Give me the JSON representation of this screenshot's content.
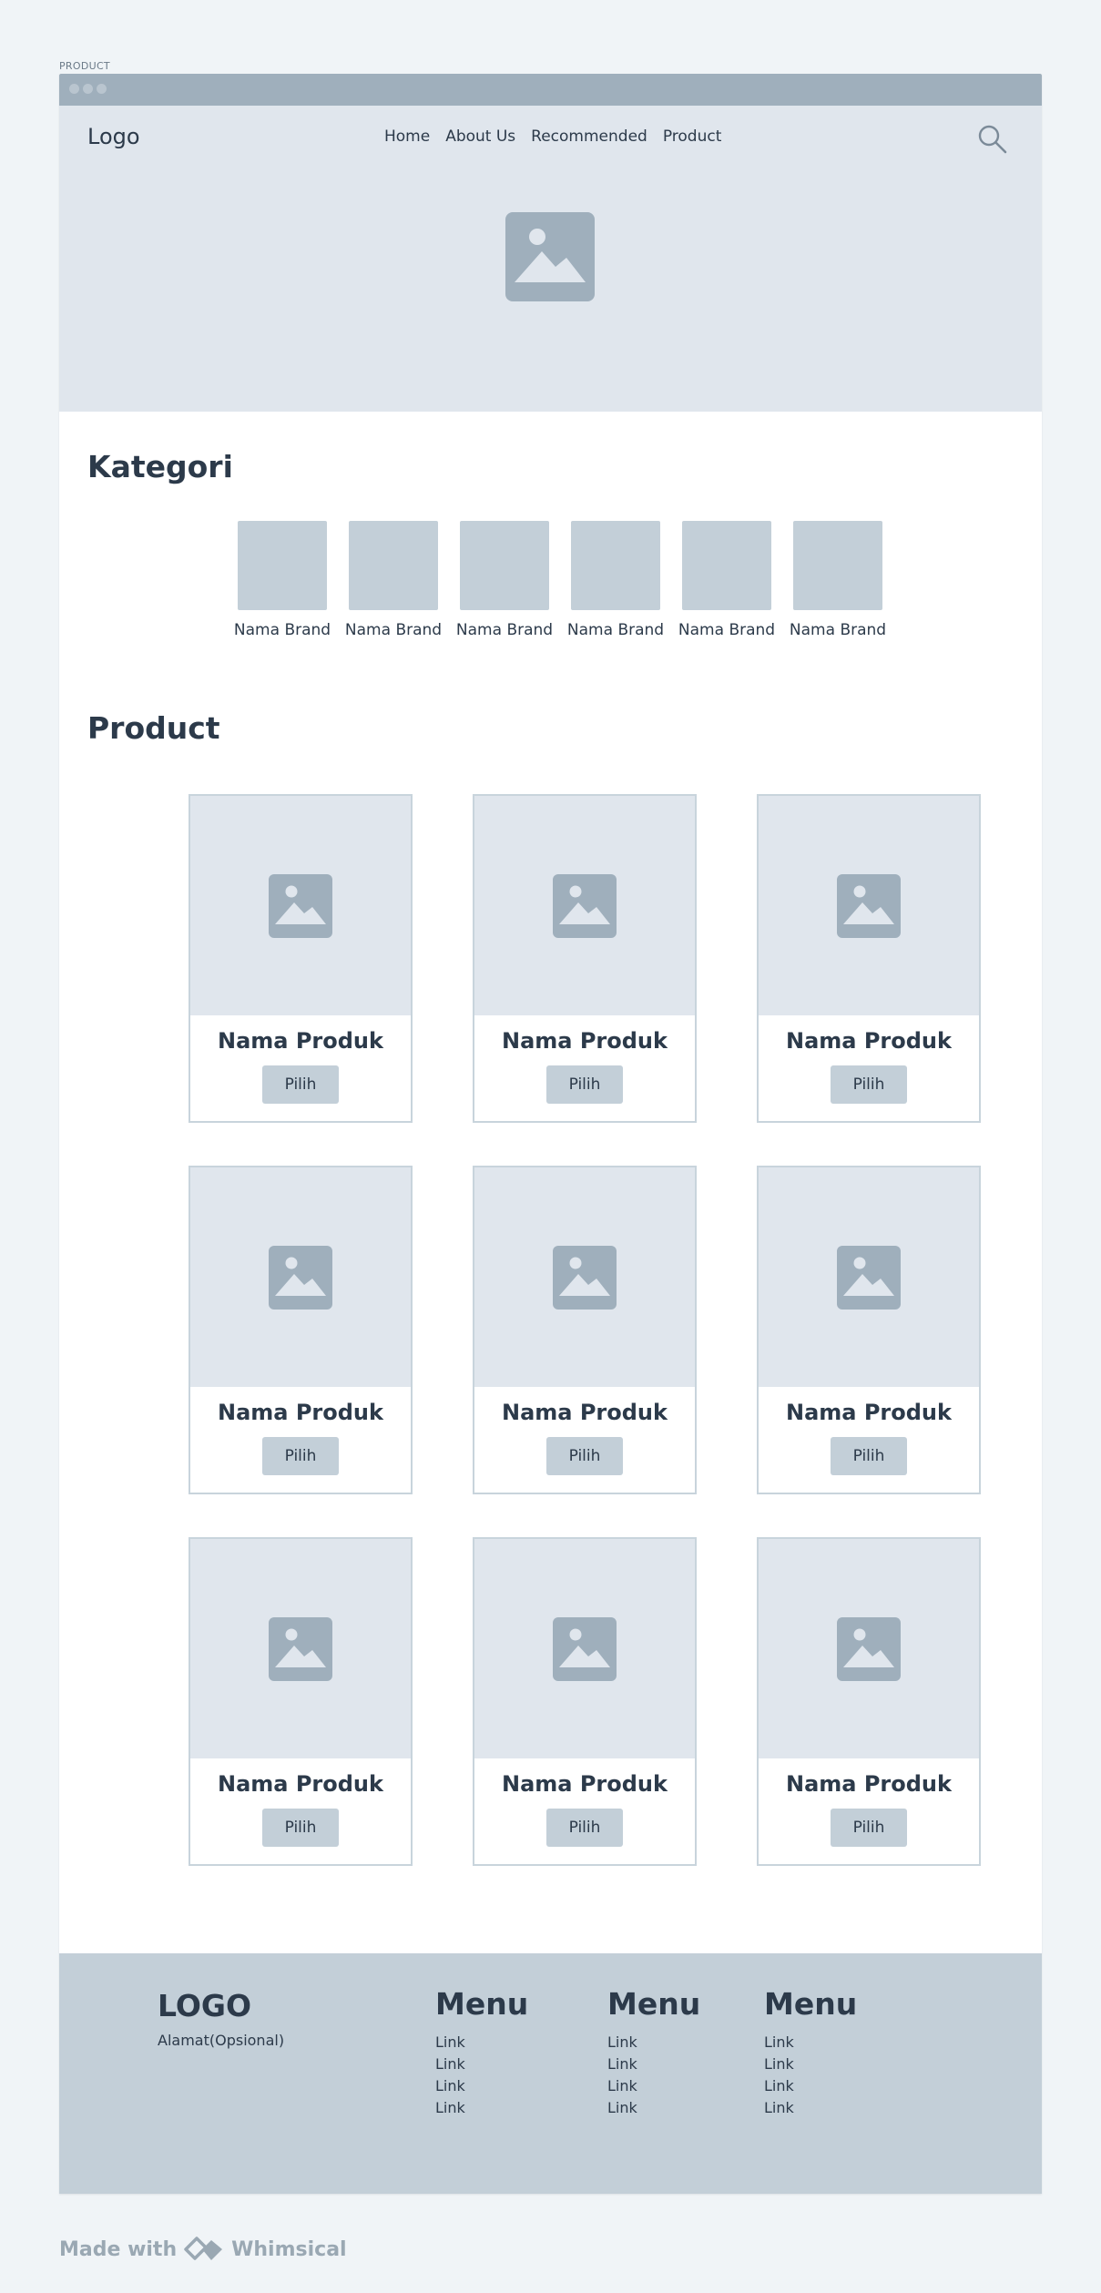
{
  "page_label": "PRODUCT",
  "header": {
    "logo": "Logo",
    "nav": [
      "Home",
      "About Us",
      "Recommended",
      "Product"
    ]
  },
  "kategori": {
    "title": "Kategori",
    "brands": [
      "Nama Brand",
      "Nama Brand",
      "Nama Brand",
      "Nama Brand",
      "Nama Brand",
      "Nama Brand"
    ]
  },
  "product": {
    "title": "Product",
    "items": [
      {
        "name": "Nama Produk",
        "button": "Pilih"
      },
      {
        "name": "Nama Produk",
        "button": "Pilih"
      },
      {
        "name": "Nama Produk",
        "button": "Pilih"
      },
      {
        "name": "Nama Produk",
        "button": "Pilih"
      },
      {
        "name": "Nama Produk",
        "button": "Pilih"
      },
      {
        "name": "Nama Produk",
        "button": "Pilih"
      },
      {
        "name": "Nama Produk",
        "button": "Pilih"
      },
      {
        "name": "Nama Produk",
        "button": "Pilih"
      },
      {
        "name": "Nama Produk",
        "button": "Pilih"
      }
    ]
  },
  "footer": {
    "logo": "LOGO",
    "address": "Alamat(Opsional)",
    "columns": [
      {
        "title": "Menu",
        "links": [
          "Link",
          "Link",
          "Link",
          "Link"
        ]
      },
      {
        "title": "Menu",
        "links": [
          "Link",
          "Link",
          "Link",
          "Link"
        ]
      },
      {
        "title": "Menu",
        "links": [
          "Link",
          "Link",
          "Link",
          "Link"
        ]
      }
    ]
  },
  "watermark": {
    "made_with": "Made with",
    "brand": "Whimsical"
  },
  "colors": {
    "hero_bg": "#e0e6ed",
    "tile": "#c3cfd8",
    "titlebar": "#9fafbc",
    "text": "#2c3a4a"
  }
}
